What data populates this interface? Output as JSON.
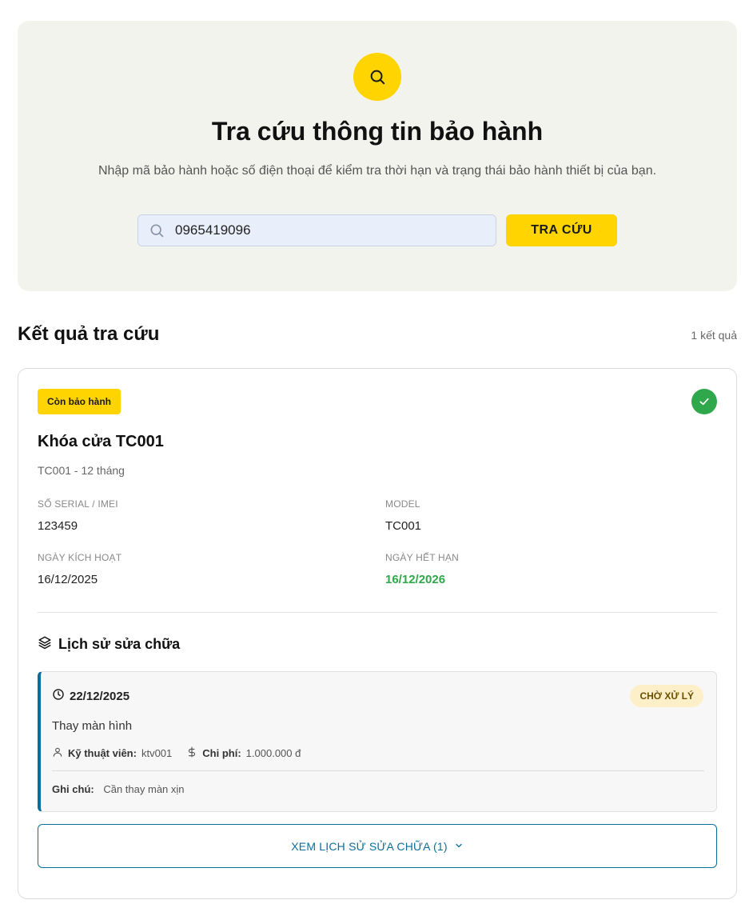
{
  "hero": {
    "title": "Tra cứu thông tin bảo hành",
    "subtitle": "Nhập mã bảo hành hoặc số điện thoại để kiểm tra thời hạn và trạng thái bảo hành thiết bị của bạn.",
    "search_value": "0965419096",
    "search_button": "TRA CỨU",
    "accent_color": "#ffd400"
  },
  "results": {
    "title": "Kết quả tra cứu",
    "count": "1 kết quả",
    "items": [
      {
        "status_badge": "Còn bảo hành",
        "product_name": "Khóa cửa TC001",
        "product_sub": "TC001 - 12 tháng",
        "serial_label": "Số serial / IMEI",
        "serial_value": "123459",
        "model_label": "Model",
        "model_value": "TC001",
        "activation_label": "Ngày kích hoạt",
        "activation_value": "16/12/2025",
        "expiry_label": "Ngày hết hạn",
        "expiry_value": "16/12/2026",
        "history_title": "Lịch sử sửa chữa",
        "repairs": [
          {
            "date": "22/12/2025",
            "status": "CHỜ XỬ LÝ",
            "description": "Thay màn hình",
            "technician_label": "Kỹ thuật viên:",
            "technician_value": "ktv001",
            "cost_label": "Chi phí:",
            "cost_value": "1.000.000 đ",
            "note_label": "Ghi chú:",
            "note_value": "Cần thay màn xịn"
          }
        ],
        "view_history_button": "XEM LỊCH SỬ SỬA CHỮA (1)"
      }
    ]
  },
  "colors": {
    "success": "#2ea84a",
    "link": "#0a6e9c",
    "pending_bg": "#fdf0c9"
  }
}
